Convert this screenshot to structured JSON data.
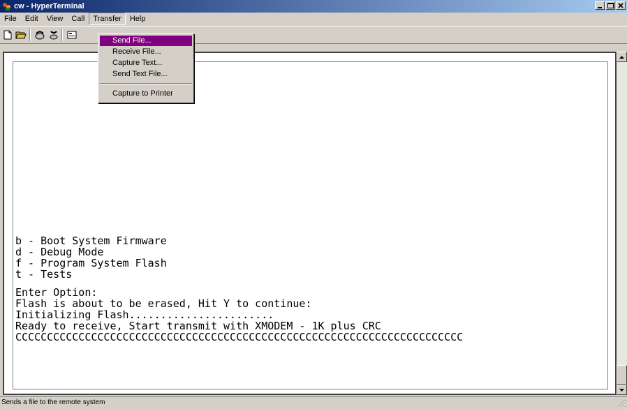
{
  "window": {
    "title": "cw - HyperTerminal",
    "app_icon": "hyperterminal-icon",
    "buttons": [
      "minimize-icon",
      "maximize-icon",
      "close-icon"
    ]
  },
  "menubar": {
    "items": [
      {
        "label": "File"
      },
      {
        "label": "Edit"
      },
      {
        "label": "View"
      },
      {
        "label": "Call"
      },
      {
        "label": "Transfer"
      },
      {
        "label": "Help"
      }
    ]
  },
  "toolbar": {
    "icons": [
      "new-connection-icon",
      "open-icon",
      "connect-icon",
      "disconnect-icon",
      "properties-icon"
    ]
  },
  "transfer_menu": {
    "items": [
      {
        "label": "Send File..."
      },
      {
        "label": "Receive File..."
      },
      {
        "label": "Capture Text..."
      },
      {
        "label": "Send Text File..."
      },
      {
        "label": "Capture to Printer"
      }
    ],
    "selected_color": "#800080"
  },
  "terminal": {
    "lines": [
      "b - Boot System Firmware",
      "d - Debug Mode",
      "f - Program System Flash",
      "t - Tests",
      "",
      "Enter Option:",
      "Flash is about to be erased, Hit Y to continue:",
      "Initializing Flash.......................",
      "Ready to receive, Start transmit with XMODEM - 1K plus CRC",
      "CCCCCCCCCCCCCCCCCCCCCCCCCCCCCCCCCCCCCCCCCCCCCCCCCCCCCCCCCCCCCCCCCCCCCCC"
    ]
  },
  "statusbar": {
    "text": "Sends a file to the remote system"
  },
  "colors": {
    "titlebar_start": "#0a246a",
    "titlebar_end": "#a6caf0",
    "chrome": "#d4d0c8"
  }
}
